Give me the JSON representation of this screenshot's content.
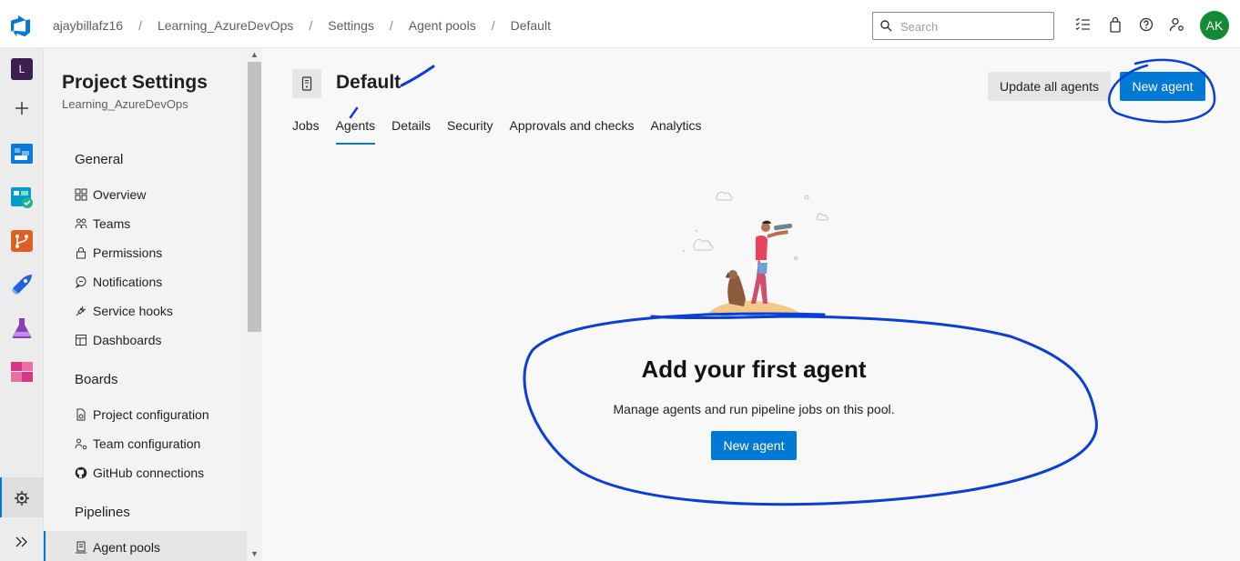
{
  "topbar": {
    "breadcrumbs": [
      "ajaybillafz16",
      "Learning_AzureDevOps",
      "Settings",
      "Agent pools",
      "Default"
    ],
    "search_placeholder": "Search",
    "avatar_initials": "AK",
    "avatar_color": "#138a36"
  },
  "rail": {
    "project_initial": "L",
    "icons": [
      "add-icon",
      "boards-icon",
      "test-plans-icon",
      "repos-icon",
      "pipelines-icon",
      "lab-icon",
      "artifacts-icon",
      "settings-gear-icon",
      "expand-icon"
    ]
  },
  "sidebar": {
    "title": "Project Settings",
    "subtitle": "Learning_AzureDevOps",
    "groups": [
      {
        "label": "General",
        "items": [
          "Overview",
          "Teams",
          "Permissions",
          "Notifications",
          "Service hooks",
          "Dashboards"
        ]
      },
      {
        "label": "Boards",
        "items": [
          "Project configuration",
          "Team configuration",
          "GitHub connections"
        ]
      },
      {
        "label": "Pipelines",
        "items": [
          "Agent pools"
        ]
      }
    ],
    "selected_item": "Agent pools"
  },
  "main": {
    "pool_name": "Default",
    "tabs": [
      "Jobs",
      "Agents",
      "Details",
      "Security",
      "Approvals and checks",
      "Analytics"
    ],
    "active_tab": "Agents",
    "update_button": "Update all agents",
    "new_agent_button": "New agent",
    "empty_title": "Add your first agent",
    "empty_subtitle": "Manage agents and run pipeline jobs on this pool.",
    "empty_button": "New agent"
  },
  "colors": {
    "accent": "#0078d4",
    "annotation": "#0a3ed4"
  }
}
